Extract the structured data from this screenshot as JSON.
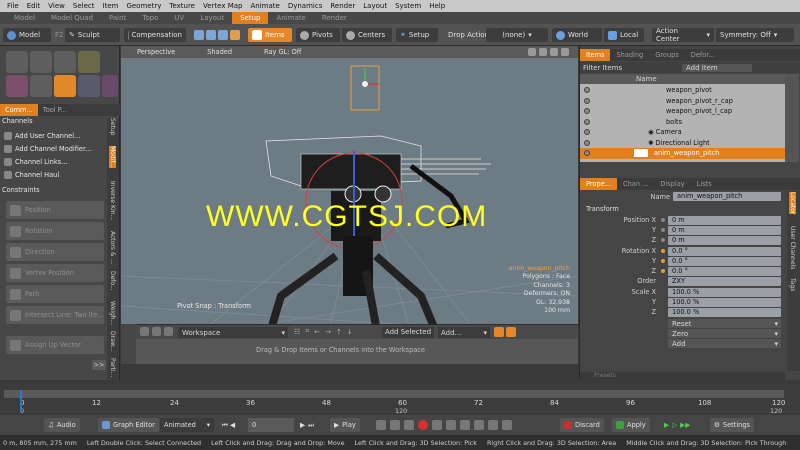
{
  "menu": [
    "File",
    "Edit",
    "View",
    "Select",
    "Item",
    "Geometry",
    "Texture",
    "Vertex Map",
    "Animate",
    "Dynamics",
    "Render",
    "Layout",
    "System",
    "Help"
  ],
  "layout_tabs": [
    "Model",
    "Model Quad",
    "Paint",
    "Topo",
    "UV",
    "Layout",
    "Setup",
    "Animate",
    "Render"
  ],
  "active_layout_tab": "Setup",
  "toolbar": {
    "model": "Model",
    "f2": "F2",
    "sculpt": "Sculpt",
    "compensation": "Compensation",
    "items": "Items",
    "pivots": "Pivots",
    "centers": "Centers",
    "setup": "Setup",
    "drop_action_label": "Drop Action",
    "drop_action_value": "(none)",
    "world": "World",
    "local": "Local",
    "action_center": "Action Center",
    "symmetry": "Symmetry: Off"
  },
  "left_panel": {
    "tab_commands": "Comm...",
    "tab_tool_props": "Tool P...",
    "side_tabs": [
      "Setup",
      "Modif...",
      "Inverse Kin...",
      "Actors & ...",
      "Defo...",
      "Weigh...",
      "Draw...",
      "Parti..."
    ],
    "channels_header": "Channels",
    "channel_items": [
      "Add User Channel...",
      "Add Channel Modifier...",
      "Channel Links...",
      "Channel Haul"
    ],
    "constraints_header": "Constraints",
    "constraint_items": [
      "Position",
      "Rotation",
      "Direction",
      "Vertex Position",
      "Path",
      "Intersect Line: Two Ite..."
    ],
    "assign_up_vector": "Assign Up Vector",
    "more": ">>"
  },
  "viewport": {
    "view_type": "Perspective",
    "shading": "Shaded",
    "raygl": "Ray GL: Off",
    "watermark": "WWW.CGTSJ.COM",
    "pivot_snap": "Pivot Snap : Transform",
    "info": [
      "anim_weapon_pitch",
      "Polygons : Face",
      "Channels: 3",
      "Deformers: ON",
      "GL: 32,938",
      "100 mm"
    ]
  },
  "workspace": {
    "dropdown": "Workspace",
    "add_selected": "Add Selected",
    "add": "Add...",
    "drop_hint": "Drag & Drop Items or Channels into the Workspace"
  },
  "right_panel": {
    "top_tabs": [
      "Items",
      "Shading",
      "Groups",
      "Defor..."
    ],
    "filter_label": "Filter Items",
    "add_item": "Add Item",
    "col_name": "Name",
    "items": [
      "weapon_pivot",
      "weapon_pivot_r_cap",
      "weapon_pivot_l_cap",
      "bolts",
      "Camera",
      "Directional Light",
      "anim_weapon_pitch"
    ],
    "selected_item": "anim_weapon_pitch",
    "prop_tabs": [
      "Prope...",
      "Chan ...",
      "Display",
      "Lists"
    ],
    "side_tabs": [
      "Locator",
      "User Channels",
      "Tags"
    ],
    "name_label": "Name",
    "name_value": "anim_weapon_pitch",
    "transform_header": "Transform",
    "position_label": "Position",
    "rotation_label": "Rotation",
    "scale_label": "Scale",
    "axes": [
      "X",
      "Y",
      "Z"
    ],
    "position": [
      "0 m",
      "0 m",
      "0 m"
    ],
    "rotation": [
      "0.0 °",
      "0.0 °",
      "0.0 °"
    ],
    "order_label": "Order",
    "order_value": "ZXY",
    "scale": [
      "100.0 %",
      "100.0 %",
      "100.0 %"
    ],
    "reset": "Reset",
    "zero": "Zero",
    "add": "Add",
    "presets": "Presets"
  },
  "timeline": {
    "ticks": [
      "0",
      "12",
      "24",
      "36",
      "48",
      "60",
      "72",
      "84",
      "96",
      "108",
      "120"
    ],
    "start": "0",
    "end": "120",
    "end_right": "120"
  },
  "playbar": {
    "audio": "Audio",
    "graph_editor": "Graph Editor",
    "animated": "Animated",
    "frame": "0",
    "play": "Play",
    "discard": "Discard",
    "apply": "Apply",
    "settings": "Settings"
  },
  "status": [
    "0 m, 805 mm, 275 mm",
    "Left Double Click: Select Connected",
    "Left Click and Drag: Drag and Drop: Move",
    "Left Click and Drag: 3D Selection: Pick",
    "Right Click and Drag: 3D Selection: Area",
    "Middle Click and Drag: 3D Selection: Pick Through"
  ]
}
